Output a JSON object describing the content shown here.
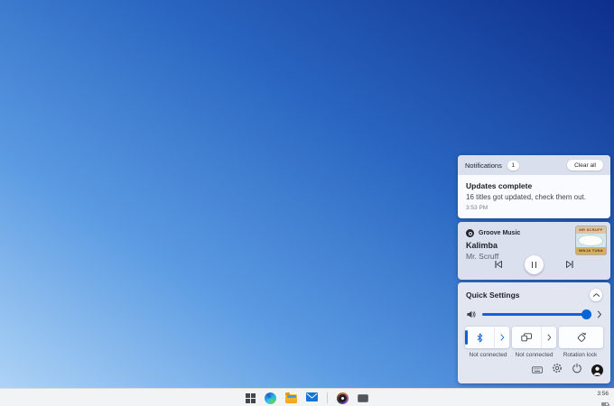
{
  "notifications": {
    "title": "Notifications",
    "count_badge": "1",
    "clear_all_label": "Clear all",
    "items": [
      {
        "title": "Updates complete",
        "message": "16 titles got updated, check them out.",
        "time": "3:53 PM"
      }
    ]
  },
  "media_player": {
    "app_name": "Groove Music",
    "track_title": "Kalimba",
    "artist": "Mr. Scruff",
    "album_art": {
      "top_text": "MR SCRUFF",
      "bottom_text": "NINJA TUNA"
    },
    "controls": [
      "previous",
      "pause",
      "next"
    ]
  },
  "quick_settings": {
    "title": "Quick Settings",
    "volume": {
      "icon": "speaker-icon",
      "level_percent": 94
    },
    "tiles": [
      {
        "icon": "bluetooth-icon",
        "label": "Not connected",
        "expandable": true,
        "active": true
      },
      {
        "icon": "cast-icon",
        "label": "Not connected",
        "expandable": true,
        "active": false
      },
      {
        "icon": "rotation-lock-icon",
        "label": "Rotation lock",
        "expandable": false,
        "active": false
      }
    ],
    "footer_icons": [
      "keyboard-icon",
      "settings-gear-icon",
      "power-icon",
      "user-avatar"
    ]
  },
  "taskbar": {
    "icons": [
      "start",
      "edge",
      "file-explorer",
      "mail",
      "groove-music",
      "app-window"
    ],
    "tray": {
      "time": "3:56",
      "icon": "battery-icon"
    }
  },
  "colors": {
    "accent_blue": "#0b63d0",
    "desktop_gradient": [
      "#aed3f6",
      "#5b9be2",
      "#2a67c2",
      "#0d2f8c"
    ],
    "panel_bg": "#e1e6f1",
    "notification_card_bg": "#fafbfe",
    "taskbar_bg": "#f2f3f5"
  }
}
